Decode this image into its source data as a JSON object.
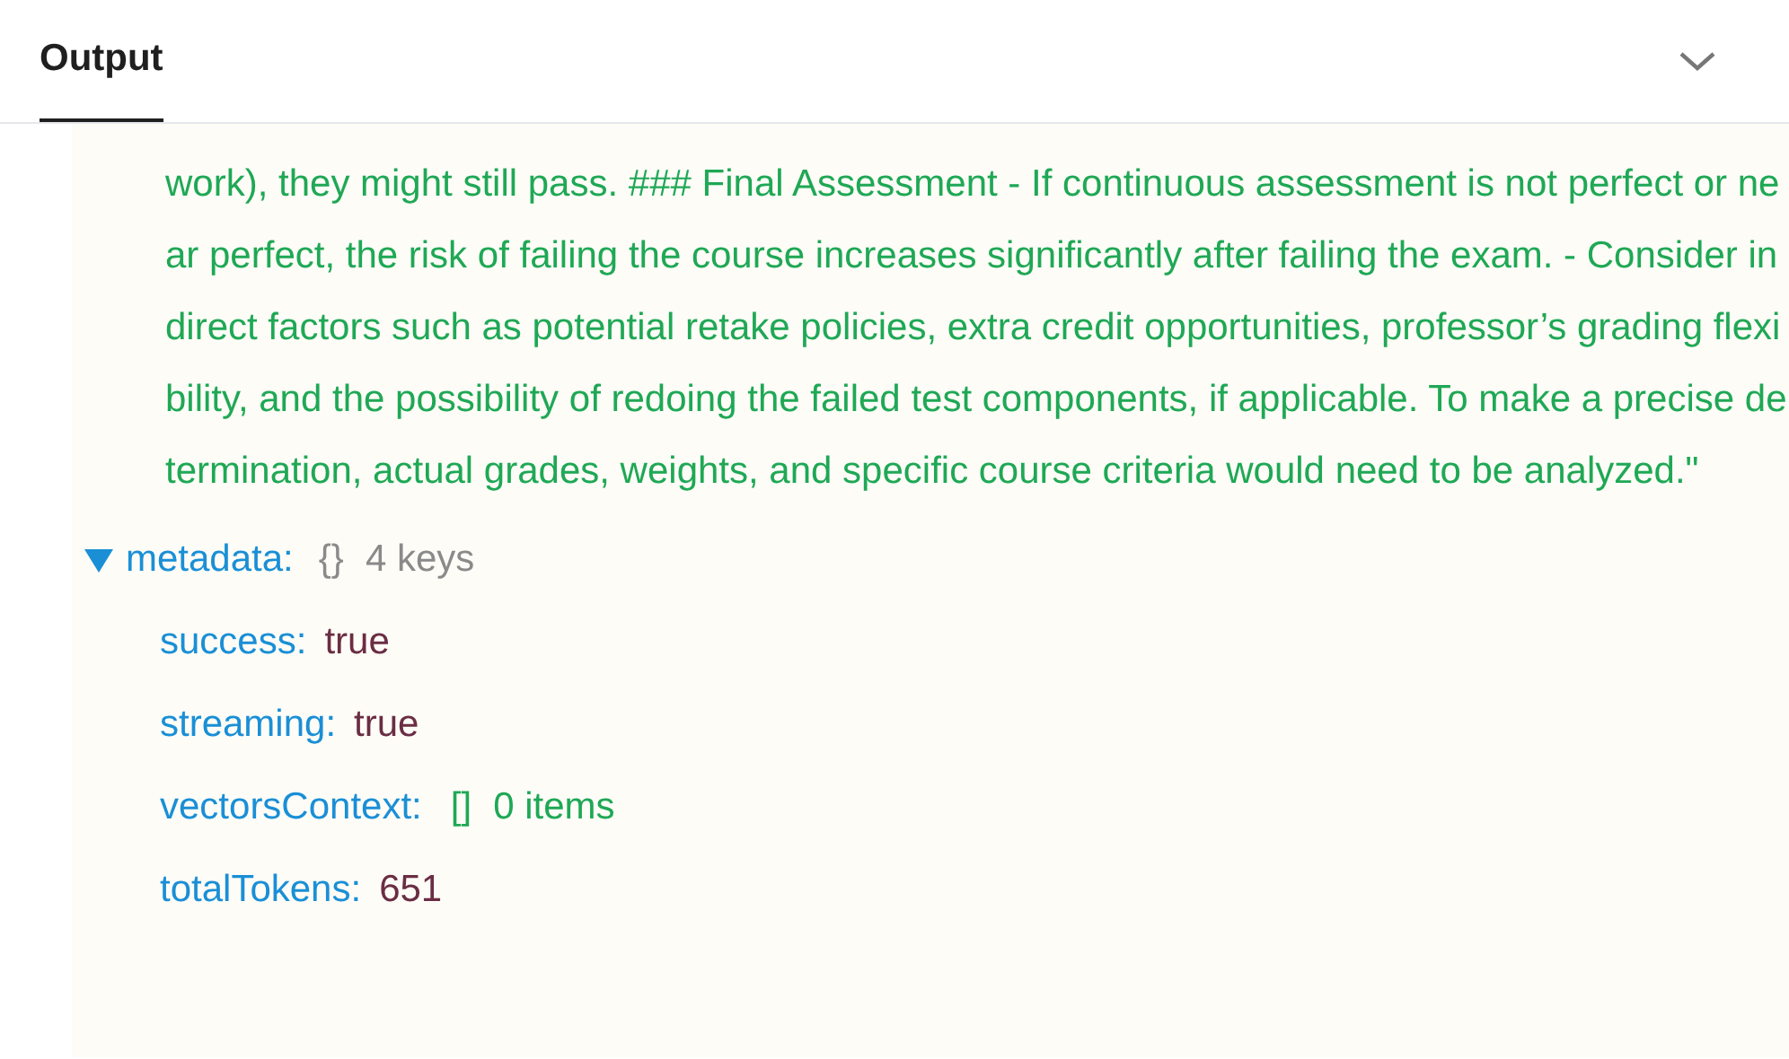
{
  "tabs": [
    {
      "label": "Output",
      "selected": true
    }
  ],
  "collapse_button": {
    "expanded": true
  },
  "output": {
    "text": "work), they might still pass. ### Final Assessment - If continuous assessment is not perfect or near perfect, the risk of failing the course increases significantly after failing the exam. - Consider indirect factors such as potential retake policies, extra credit opportunities, professor’s grading flexibility, and the possibility of redoing the failed test components, if applicable. To make a precise determination, actual grades, weights, and specific course criteria would need to be analyzed.\"",
    "tree": [
      {
        "key": "metadata:",
        "kind": "object",
        "brackets": "{}",
        "summary": "4 keys",
        "expanded": true,
        "children": [
          {
            "key": "success:",
            "kind": "boolean",
            "value": "true"
          },
          {
            "key": "streaming:",
            "kind": "boolean",
            "value": "true"
          },
          {
            "key": "vectorsContext:",
            "kind": "array",
            "brackets": "[]",
            "summary": "0 items"
          },
          {
            "key": "totalTokens:",
            "kind": "number",
            "value": "651"
          }
        ]
      }
    ]
  }
}
